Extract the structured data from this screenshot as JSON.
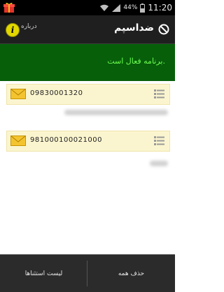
{
  "statusbar": {
    "battery": "44%",
    "time": "11:20"
  },
  "actionbar": {
    "title": "ضداسپم",
    "about_label": "درباره"
  },
  "banner": {
    "status_text": "برنامه فعال است."
  },
  "list": {
    "items": [
      {
        "number": "09830001320"
      },
      {
        "number": "981000100021000"
      }
    ]
  },
  "bottom": {
    "delete_all": "حذف همه",
    "exceptions": "لیست استثناها"
  },
  "colors": {
    "banner_bg": "#075f0a",
    "banner_text": "#6cff4f",
    "item_bg": "#fbf5cf",
    "envelope": "#f1c232"
  }
}
